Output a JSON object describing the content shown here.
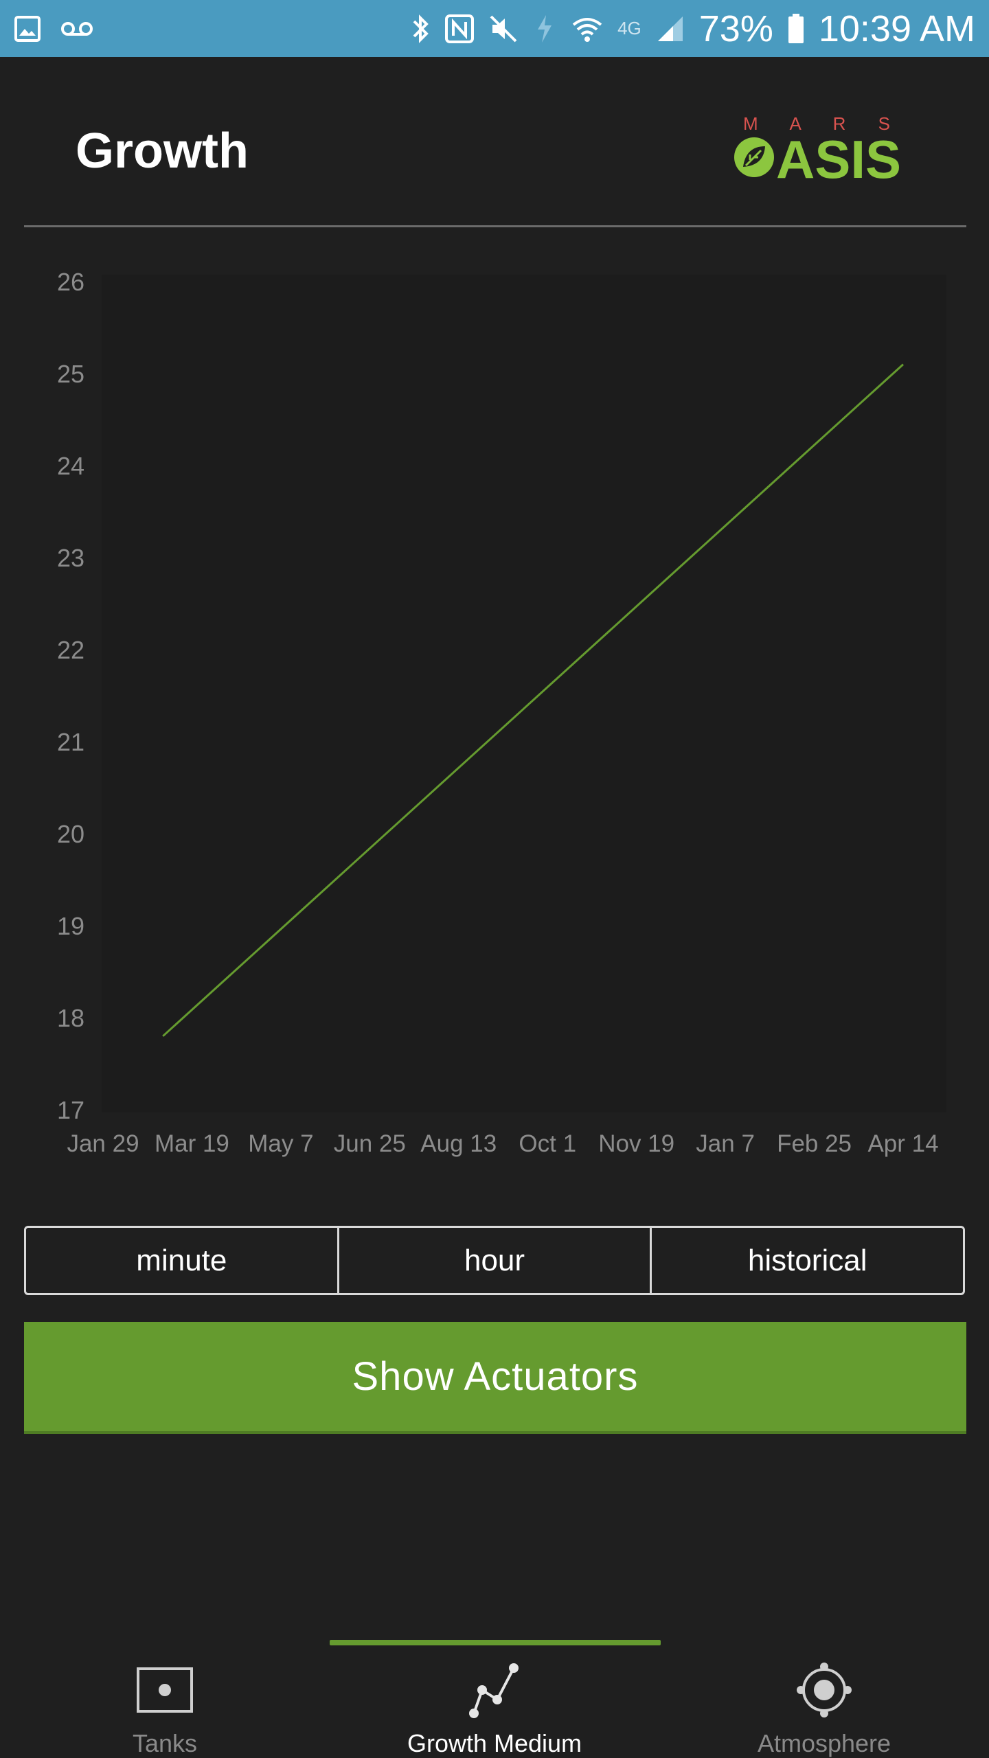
{
  "status_bar": {
    "battery_percent": "73%",
    "time": "10:39 AM",
    "network_label": "4G",
    "icons": [
      "gallery-icon",
      "voicemail-icon",
      "bluetooth-icon",
      "nfc-icon",
      "mute-icon",
      "data-saver-icon",
      "wifi-icon",
      "signal-icon",
      "battery-icon"
    ]
  },
  "header": {
    "title": "Growth",
    "logo": {
      "top_text": "M A R S",
      "main_text": "ASIS"
    }
  },
  "chart_data": {
    "type": "line",
    "x": [
      "Mar 2 2016",
      "Apr 14 2017"
    ],
    "series": [
      {
        "values": [
          17.8,
          25.1
        ],
        "color": "#659b2f"
      }
    ],
    "x_tick_labels": [
      "Jan 29",
      "Mar 19",
      "May 7",
      "Jun 25",
      "Aug 13",
      "Oct 1",
      "Nov 19",
      "Jan 7",
      "Feb 25",
      "Apr 14"
    ],
    "y_tick_labels": [
      "17",
      "18",
      "19",
      "20",
      "21",
      "22",
      "23",
      "24",
      "25",
      "26"
    ],
    "ylim": [
      17,
      26
    ],
    "grid": false
  },
  "range_selector": {
    "options": [
      "minute",
      "hour",
      "historical"
    ]
  },
  "actuators_button": {
    "label": "Show Actuators"
  },
  "bottom_nav": {
    "tabs": [
      {
        "label": "Tanks",
        "icon": "tank-icon",
        "active": false
      },
      {
        "label": "Growth Medium",
        "icon": "growth-chart-icon",
        "active": true
      },
      {
        "label": "Atmosphere",
        "icon": "atmosphere-icon",
        "active": false
      }
    ],
    "accent": "#659b2f"
  },
  "colors": {
    "background": "#1f1f1f",
    "status_bar": "#4a9bc0",
    "accent": "#659b2f",
    "logo_red": "#d9534f",
    "logo_green": "#8cc63f"
  }
}
